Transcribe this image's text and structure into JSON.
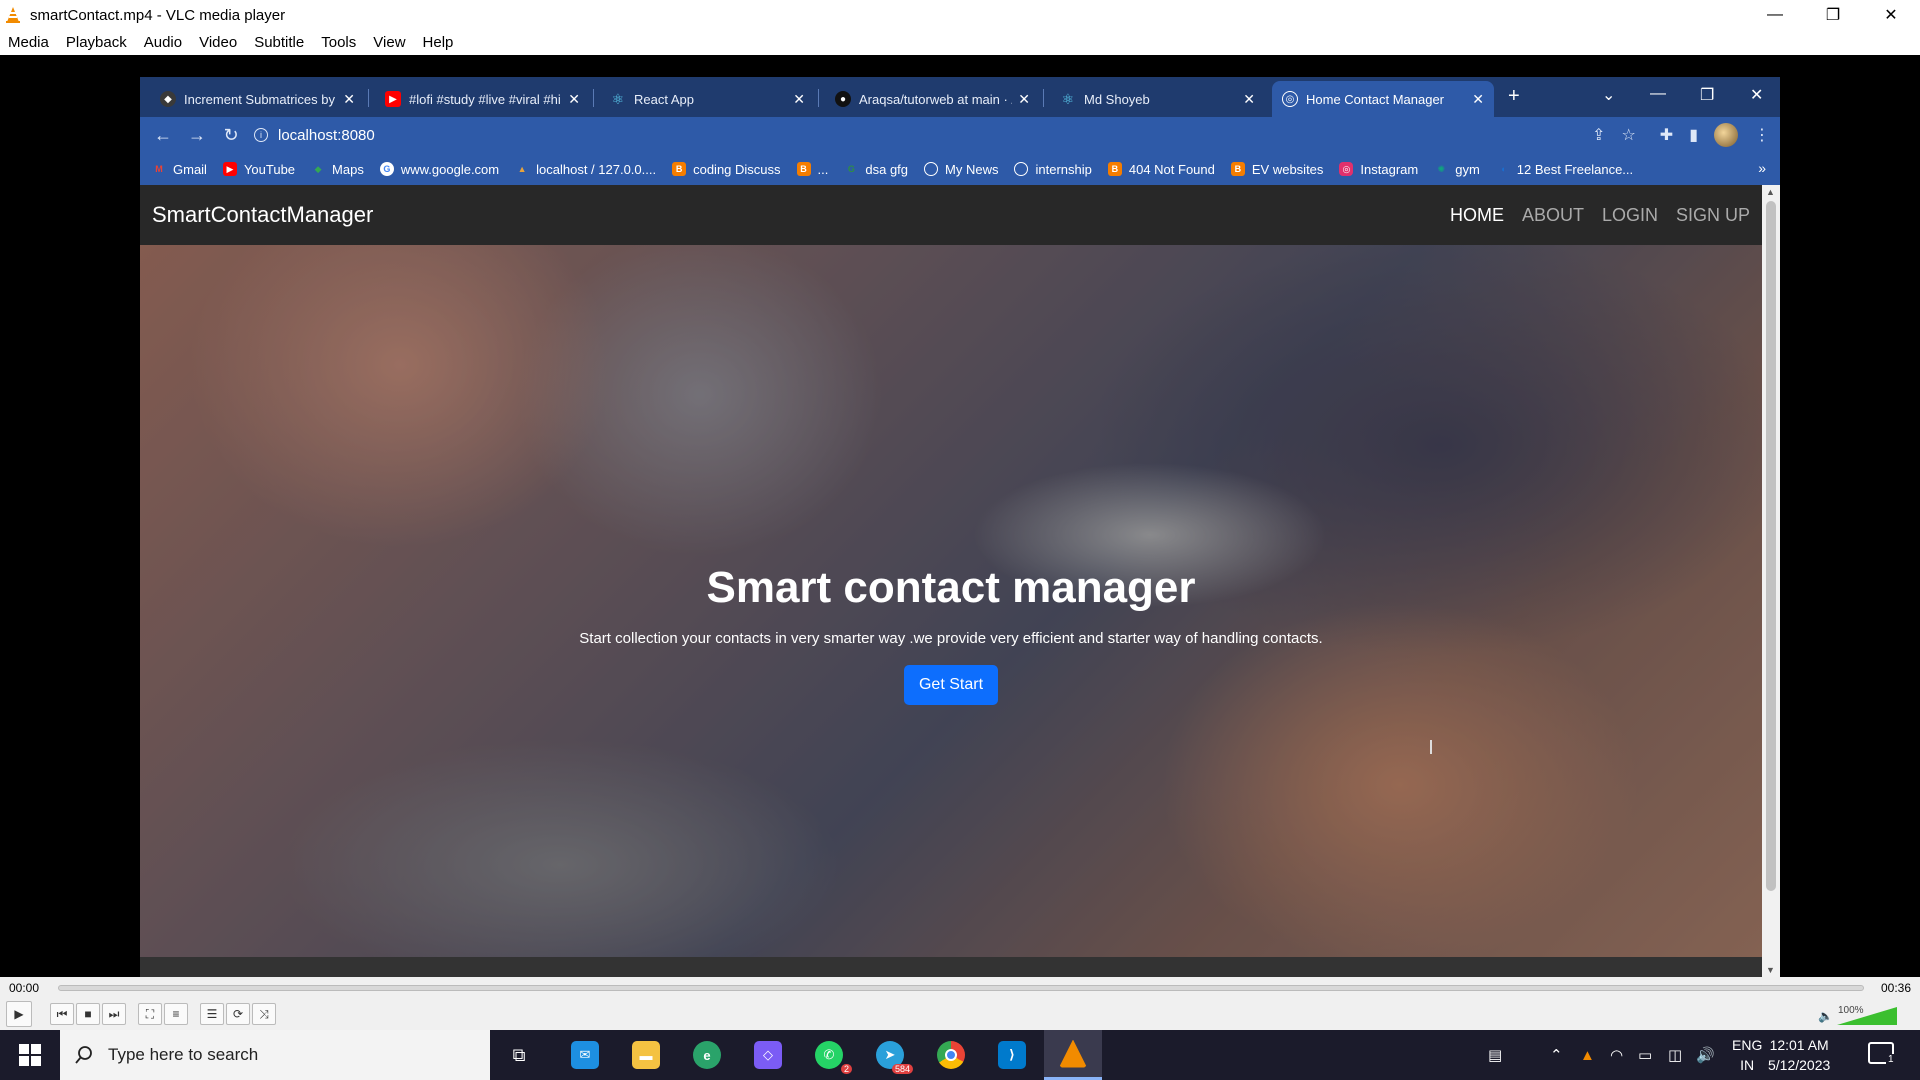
{
  "vlc": {
    "title": "smartContact.mp4 - VLC media player",
    "menu": [
      "Media",
      "Playback",
      "Audio",
      "Video",
      "Subtitle",
      "Tools",
      "View",
      "Help"
    ],
    "time_elapsed": "00:00",
    "time_total": "00:36",
    "volume_label": "100%",
    "volume_level": 1.0,
    "playback_progress": 0.0
  },
  "browser": {
    "tabs": [
      {
        "title": "Increment Submatrices by C",
        "favicon": "seo-icon",
        "color": "#3a3a3a"
      },
      {
        "title": "#lofi #study #live #viral #hi",
        "favicon": "youtube-icon",
        "color": "#ff0000"
      },
      {
        "title": "React App",
        "favicon": "react-icon",
        "color": "#61dafb"
      },
      {
        "title": "Araqsa/tutorweb at main · /",
        "favicon": "github-icon",
        "color": "#111111"
      },
      {
        "title": "Md Shoyeb",
        "favicon": "react-icon",
        "color": "#61dafb"
      },
      {
        "title": "Home Contact Manager",
        "favicon": "globe-icon",
        "color": "#ffffff"
      }
    ],
    "url": "localhost:8080",
    "bookmarks": [
      {
        "label": "Gmail",
        "icon": "gmail-icon",
        "color": "#ea4335",
        "glyph": "M"
      },
      {
        "label": "YouTube",
        "icon": "youtube-icon",
        "color": "#ff0000",
        "glyph": "▶"
      },
      {
        "label": "Maps",
        "icon": "maps-icon",
        "color": "#34a853",
        "glyph": "◆"
      },
      {
        "label": "www.google.com",
        "icon": "google-icon",
        "color": "#4285f4",
        "glyph": "G"
      },
      {
        "label": "localhost / 127.0.0....",
        "icon": "phpmyadmin-icon",
        "color": "#e8a33b",
        "glyph": "▲"
      },
      {
        "label": "coding Discuss",
        "icon": "blogger-icon",
        "color": "#f57d00",
        "glyph": "B"
      },
      {
        "label": "...",
        "icon": "blogger-icon",
        "color": "#f57d00",
        "glyph": "B"
      },
      {
        "label": "dsa gfg",
        "icon": "gfg-icon",
        "color": "#2f8d46",
        "glyph": "G"
      },
      {
        "label": "My News",
        "icon": "globe-icon",
        "color": "#ffffff",
        "glyph": "◎"
      },
      {
        "label": "internship",
        "icon": "globe-icon",
        "color": "#ffffff",
        "glyph": "◎"
      },
      {
        "label": "404 Not Found",
        "icon": "blogger-icon",
        "color": "#f57d00",
        "glyph": "B"
      },
      {
        "label": "EV websites",
        "icon": "blogger-icon",
        "color": "#f57d00",
        "glyph": "B"
      },
      {
        "label": "Instagram",
        "icon": "instagram-icon",
        "color": "#e1306c",
        "glyph": "◎"
      },
      {
        "label": "gym",
        "icon": "chatgpt-icon",
        "color": "#10a37f",
        "glyph": "✺"
      },
      {
        "label": "12 Best Freelance...",
        "icon": "freelance-icon",
        "color": "#1a6fd1",
        "glyph": "◖"
      }
    ]
  },
  "site": {
    "brand": "SmartContactManager",
    "nav": [
      "HOME",
      "ABOUT",
      "LOGIN",
      "SIGN UP"
    ],
    "hero_title": "Smart contact manager",
    "hero_subtitle": "Start collection your contacts in very smarter way .we provide very efficient and starter way of handling contacts.",
    "hero_button": "Get Start"
  },
  "taskbar": {
    "search_placeholder": "Type here to search",
    "apps": [
      {
        "name": "task-view",
        "color": "#1b1b2b"
      },
      {
        "name": "mail",
        "color": "#1d8fe1"
      },
      {
        "name": "file-explorer",
        "color": "#f4c242"
      },
      {
        "name": "edge",
        "color": "#2aa36a"
      },
      {
        "name": "copilot",
        "color": "#7b5cf5"
      },
      {
        "name": "whatsapp",
        "color": "#25d366",
        "badge": "2"
      },
      {
        "name": "telegram",
        "color": "#2aa0da",
        "badge": "584"
      },
      {
        "name": "chrome",
        "color": "#ea4335"
      },
      {
        "name": "vscode",
        "color": "#007acc"
      },
      {
        "name": "vlc",
        "color": "#f28b00"
      }
    ],
    "language": "ENG",
    "region": "IN",
    "time": "12:01 AM",
    "date": "5/12/2023",
    "notifications": "1"
  }
}
